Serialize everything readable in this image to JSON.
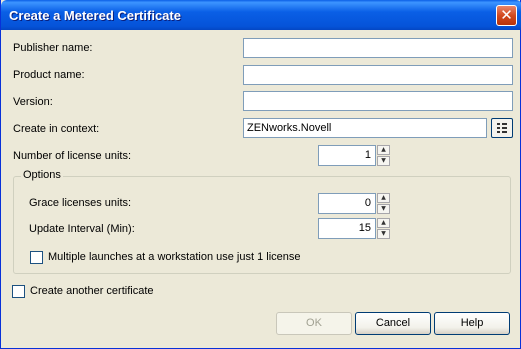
{
  "window": {
    "title": "Create a Metered Certificate",
    "close_icon": "close-icon"
  },
  "form": {
    "publisher_label": "Publisher name:",
    "publisher_value": "",
    "product_label": "Product name:",
    "product_value": "",
    "version_label": "Version:",
    "version_value": "",
    "context_label": "Create in context:",
    "context_value": "ZENworks.Novell",
    "license_units_label": "Number of license units:",
    "license_units_value": "1"
  },
  "options": {
    "group_label": "Options",
    "grace_label": "Grace licenses units:",
    "grace_value": "0",
    "interval_label": "Update Interval (Min):",
    "interval_value": "15",
    "multiple_launch_label": "Multiple launches at a workstation use just 1 license",
    "multiple_launch_checked": false
  },
  "create_another_label": "Create another certificate",
  "create_another_checked": false,
  "buttons": {
    "ok": "OK",
    "cancel": "Cancel",
    "help": "Help"
  }
}
